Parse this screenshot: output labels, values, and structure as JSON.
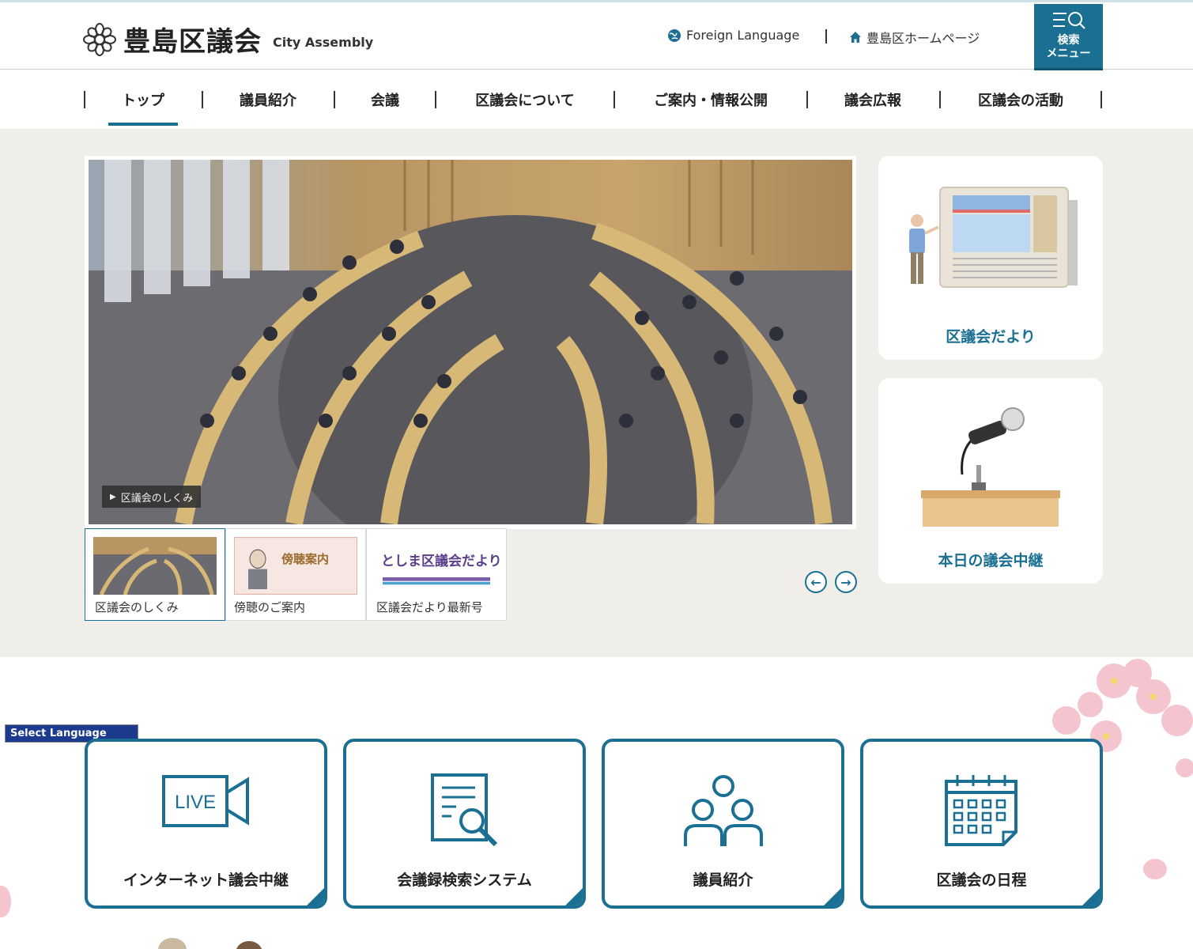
{
  "header": {
    "logo_jp": "豊島区議会",
    "logo_en": "City Assembly",
    "foreign_language": "Foreign Language",
    "homepage": "豊島区ホームページ",
    "search_menu": "検索\nメニュー"
  },
  "gnav": {
    "items": [
      {
        "label": "トップ"
      },
      {
        "label": "議員紹介"
      },
      {
        "label": "会議"
      },
      {
        "label": "区議会について"
      },
      {
        "label": "ご案内・情報公開"
      },
      {
        "label": "議会広報"
      },
      {
        "label": "区議会の活動"
      }
    ],
    "active": "トップ"
  },
  "hero": {
    "slide_caption": "区議会のしくみ",
    "thumbs": [
      {
        "label": "区議会のしくみ"
      },
      {
        "label": "傍聴のご案内",
        "banner_text": "傍聴案内"
      },
      {
        "label": "区議会だより最新号",
        "banner_text": "としま区議会だより"
      }
    ],
    "prev_arrow": "←",
    "next_arrow": "→"
  },
  "side_cards": [
    {
      "label": "区議会だより"
    },
    {
      "label": "本日の議会中継"
    }
  ],
  "language_select": {
    "value": "Select Language"
  },
  "tiles": [
    {
      "label": "インターネット議会中継",
      "icon": "live-camera-icon",
      "icon_text": "LIVE"
    },
    {
      "label": "会議録検索システム",
      "icon": "document-search-icon"
    },
    {
      "label": "議員紹介",
      "icon": "members-icon"
    },
    {
      "label": "区議会の日程",
      "icon": "calendar-icon"
    }
  ],
  "colors": {
    "accent": "#1b6f93",
    "hero_bg": "#efeee8"
  }
}
